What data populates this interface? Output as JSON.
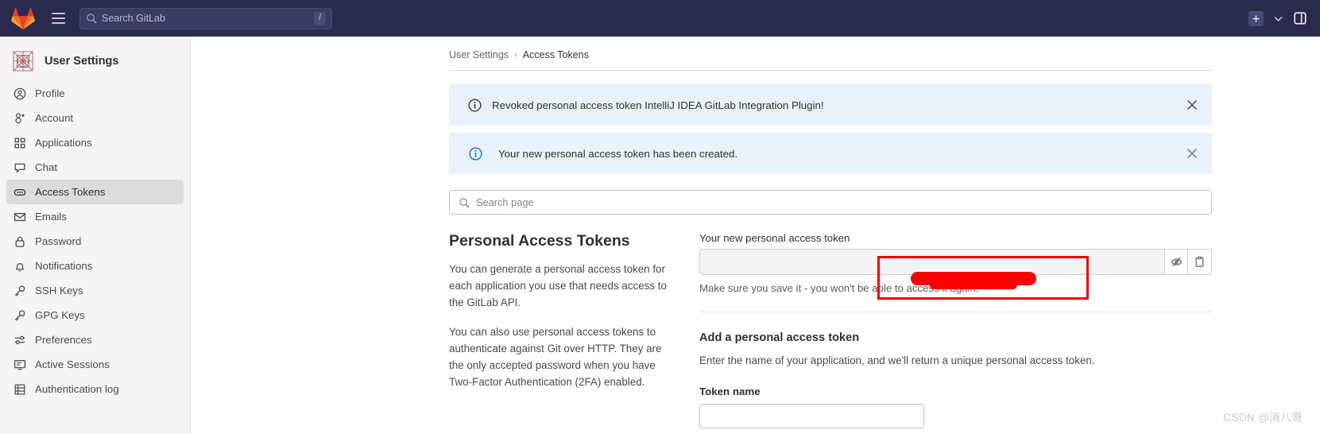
{
  "navbar": {
    "logo_icon": "gitlab-logo-icon",
    "menu_icon": "hamburger-menu-icon",
    "search_icon": "search-icon",
    "search_placeholder": "Search GitLab",
    "search_shortcut": "/",
    "plus_icon": "plus-square-icon",
    "chevron_icon": "chevron-down-icon",
    "issues_icon": "issues-icon",
    "bg_color": "#2b2b50"
  },
  "sidebar": {
    "avatar_icon": "user-avatar-icon",
    "title": "User Settings",
    "active_item": "Access Tokens",
    "items": [
      {
        "label": "Profile",
        "icon": "profile-icon"
      },
      {
        "label": "Account",
        "icon": "account-icon"
      },
      {
        "label": "Applications",
        "icon": "applications-grid-icon"
      },
      {
        "label": "Chat",
        "icon": "chat-bubble-icon"
      },
      {
        "label": "Access Tokens",
        "icon": "token-icon"
      },
      {
        "label": "Emails",
        "icon": "envelope-icon"
      },
      {
        "label": "Password",
        "icon": "lock-icon"
      },
      {
        "label": "Notifications",
        "icon": "bell-icon"
      },
      {
        "label": "SSH Keys",
        "icon": "key-icon"
      },
      {
        "label": "GPG Keys",
        "icon": "key-icon"
      },
      {
        "label": "Preferences",
        "icon": "sliders-icon"
      },
      {
        "label": "Active Sessions",
        "icon": "monitor-icon"
      },
      {
        "label": "Authentication log",
        "icon": "list-table-icon"
      }
    ]
  },
  "breadcrumb": {
    "root": "User Settings",
    "separator": "›",
    "current": "Access Tokens"
  },
  "alerts": [
    {
      "icon": "info-circle-icon",
      "icon_color": "#303030",
      "message": "Revoked personal access token IntelliJ IDEA GitLab Integration Plugin!",
      "close_icon": "close-icon",
      "bg_color": "#e9f1fa"
    },
    {
      "icon": "info-circle-icon",
      "icon_color": "#1f75cb",
      "message": "Your new personal access token has been created.",
      "close_icon": "close-icon",
      "bg_color": "#e9f1fa"
    }
  ],
  "search_page": {
    "icon": "search-icon",
    "placeholder": "Search page",
    "value": ""
  },
  "left_column": {
    "heading": "Personal Access Tokens",
    "paragraph_1": "You can generate a personal access token for each application you use that needs access to the GitLab API.",
    "paragraph_2": "You can also use personal access tokens to authenticate against Git over HTTP. They are the only accepted password when you have Two-Factor Authentication (2FA) enabled."
  },
  "token_panel": {
    "label": "Your new personal access token",
    "value": "",
    "reveal_icon": "eye-slash-icon",
    "copy_icon": "clipboard-copy-icon",
    "hint": "Make sure you save it - you won't be able to access it again."
  },
  "add_token": {
    "title": "Add a personal access token",
    "description": "Enter the name of your application, and we'll return a unique personal access token.",
    "name_label": "Token name",
    "name_value": "",
    "name_placeholder": ""
  },
  "annotation": {
    "highlight_color": "#ef0000",
    "redaction_color": "#fb0000"
  },
  "watermark": {
    "text": "CSDN @消八哥"
  }
}
